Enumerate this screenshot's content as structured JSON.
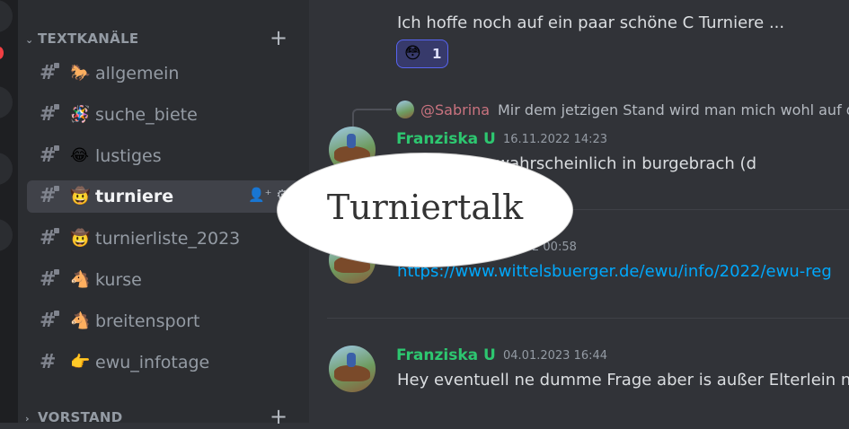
{
  "sidebar": {
    "category_text": {
      "label": "TEXTKANÄLE",
      "add_label": "+"
    },
    "channels": [
      {
        "emoji": "🐎",
        "name": "allgemein",
        "active": false
      },
      {
        "emoji": "🪅",
        "name": "suche_biete",
        "active": false
      },
      {
        "emoji": "😂",
        "name": "lustiges",
        "active": false
      },
      {
        "emoji": "🤠",
        "name": "turniere",
        "active": true
      },
      {
        "emoji": "🤠",
        "name": "turnierliste_2023",
        "active": false
      },
      {
        "emoji": "🐴",
        "name": "kurse",
        "active": false
      },
      {
        "emoji": "🐴",
        "name": "breitensport",
        "active": false
      },
      {
        "emoji": "👉",
        "name": "ewu_infotage",
        "active": false
      }
    ],
    "category_vorstand": {
      "label": "VORSTAND",
      "add_label": "+"
    },
    "channel_icons": {
      "invite": "add-member-icon",
      "settings": "gear-icon"
    }
  },
  "messages": {
    "m1": {
      "text": "Ich hoffe noch auf ein paar schöne C Turniere ...",
      "reaction": {
        "emoji": "😳",
        "count": "1"
      }
    },
    "m2": {
      "reply_author": "@Sabrina",
      "reply_text": "Mir dem jetzigen Stand wird man mich wohl auf d",
      "author": "Franziska U",
      "timestamp": "16.11.2022 14:23",
      "text": "hen wir uns wahrscheinlich in burgebrach (d"
    },
    "m3": {
      "timestamp": "2 00:58",
      "link": "https://www.wittelsbuerger.de/ewu/info/2022/ewu-reg"
    },
    "m4": {
      "author": "Franziska U",
      "timestamp": "04.01.2023 16:44",
      "text": "Hey eventuell ne dumme Frage aber is außer Elterlein n"
    }
  },
  "overlay": {
    "label": "Turniertalk"
  },
  "colors": {
    "author": "#2dc770",
    "link": "#00a8fc",
    "mention": "#c9737f",
    "accent": "#5865f2"
  }
}
